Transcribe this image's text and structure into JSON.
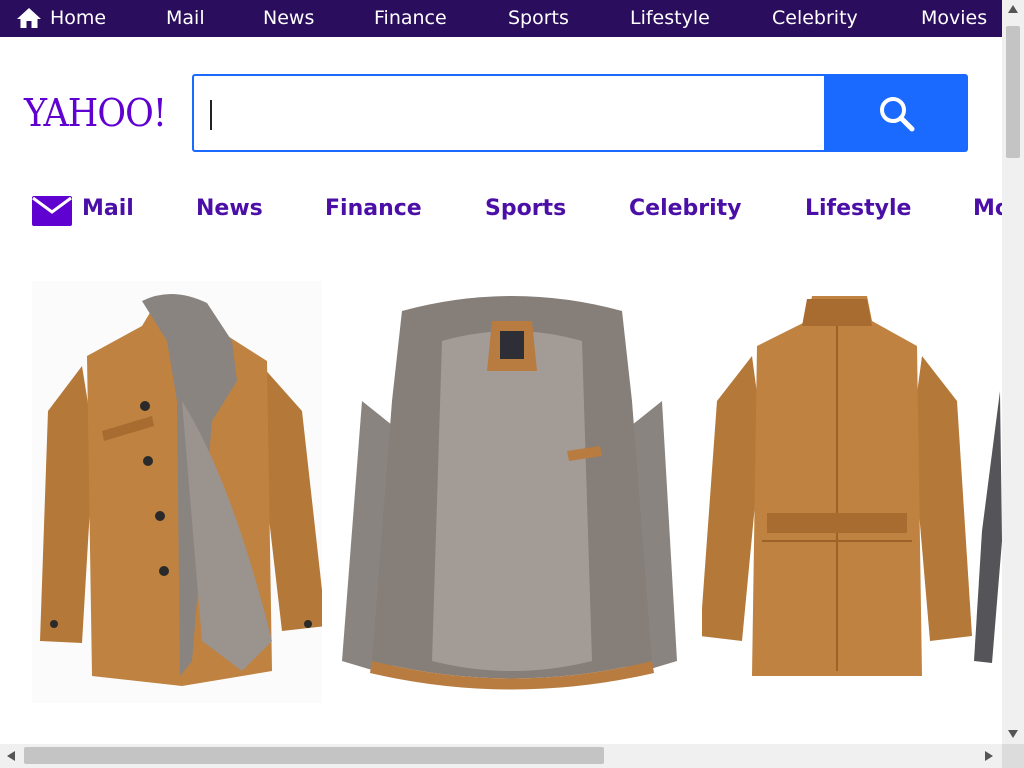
{
  "top_nav": {
    "items": [
      "Home",
      "Mail",
      "News",
      "Finance",
      "Sports",
      "Lifestyle",
      "Celebrity",
      "Movies"
    ]
  },
  "logo": {
    "text": "YAHOO!"
  },
  "search": {
    "value": "",
    "placeholder": ""
  },
  "secondary_nav": {
    "items": [
      "Mail",
      "News",
      "Finance",
      "Sports",
      "Celebrity",
      "Lifestyle",
      "Mo"
    ]
  },
  "gallery": {
    "images": [
      "jacket-front-icon",
      "jacket-open-lining-icon",
      "jacket-back-icon",
      "jacket-partial-icon"
    ]
  },
  "colors": {
    "top_nav_bg": "#2b0d5e",
    "brand_purple": "#5f01d1",
    "link_purple": "#4b0fa8",
    "search_blue": "#1a6aff",
    "leather": "#b87c40",
    "fur": "#8a8480"
  },
  "scrollbars": {
    "horizontal_position": 0.0,
    "vertical_position": 0.0
  }
}
